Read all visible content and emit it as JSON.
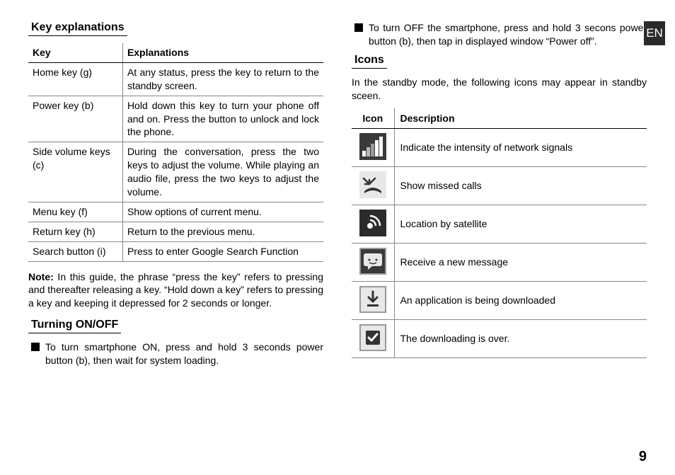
{
  "lang_badge": "EN",
  "page_number": "9",
  "left": {
    "key_explanations_title": "Key explanations",
    "key_table": {
      "headers": {
        "key": "Key",
        "explanation": "Explanations"
      },
      "rows": [
        {
          "key": "Home key (g)",
          "explanation": "At any status, press the key to return to the standby screen."
        },
        {
          "key": "Power key (b)",
          "explanation": "Hold down this key to turn your phone off and on.\nPress the button to unlock and lock the phone."
        },
        {
          "key": "Side volume keys (c)",
          "explanation": "During the conversation, press the two keys to adjust the volume. While playing an audio file, press the two keys to adjust the volume."
        },
        {
          "key": "Menu key (f)",
          "explanation": "Show options of current menu."
        },
        {
          "key": "Return key (h)",
          "explanation": "Return to the previous menu."
        },
        {
          "key": "Search button (i)",
          "explanation": "Press to enter Google Search Function"
        }
      ]
    },
    "note_label": "Note:",
    "note_text": " In this guide, the phrase “press the key” refers to pressing and thereafter releasing a key. “Hold down a key” refers to pressing a key and keeping it depressed for 2 seconds or longer.",
    "turning_title": "Turning ON/OFF",
    "turning_on": "To turn smartphone ON, press and hold 3 seconds power button (b), then wait for system loading."
  },
  "right": {
    "turning_off": "To turn OFF the smartphone, press and hold 3 secons power button (b), then tap in displayed window “Power off”.",
    "icons_title": "Icons",
    "icons_intro": "In the standby mode, the following icons may appear in standby sceen.",
    "icon_table": {
      "headers": {
        "icon": "Icon",
        "description": "Description"
      },
      "rows": [
        {
          "icon_name": "signal-icon",
          "description": "Indicate the intensity of network signals"
        },
        {
          "icon_name": "missed-call-icon",
          "description": "Show missed calls"
        },
        {
          "icon_name": "satellite-icon",
          "description": "Location by satellite"
        },
        {
          "icon_name": "message-icon",
          "description": "Receive a new message"
        },
        {
          "icon_name": "download-icon",
          "description": "An application is being downloaded"
        },
        {
          "icon_name": "download-done-icon",
          "description": "The downloading is over."
        }
      ]
    }
  }
}
